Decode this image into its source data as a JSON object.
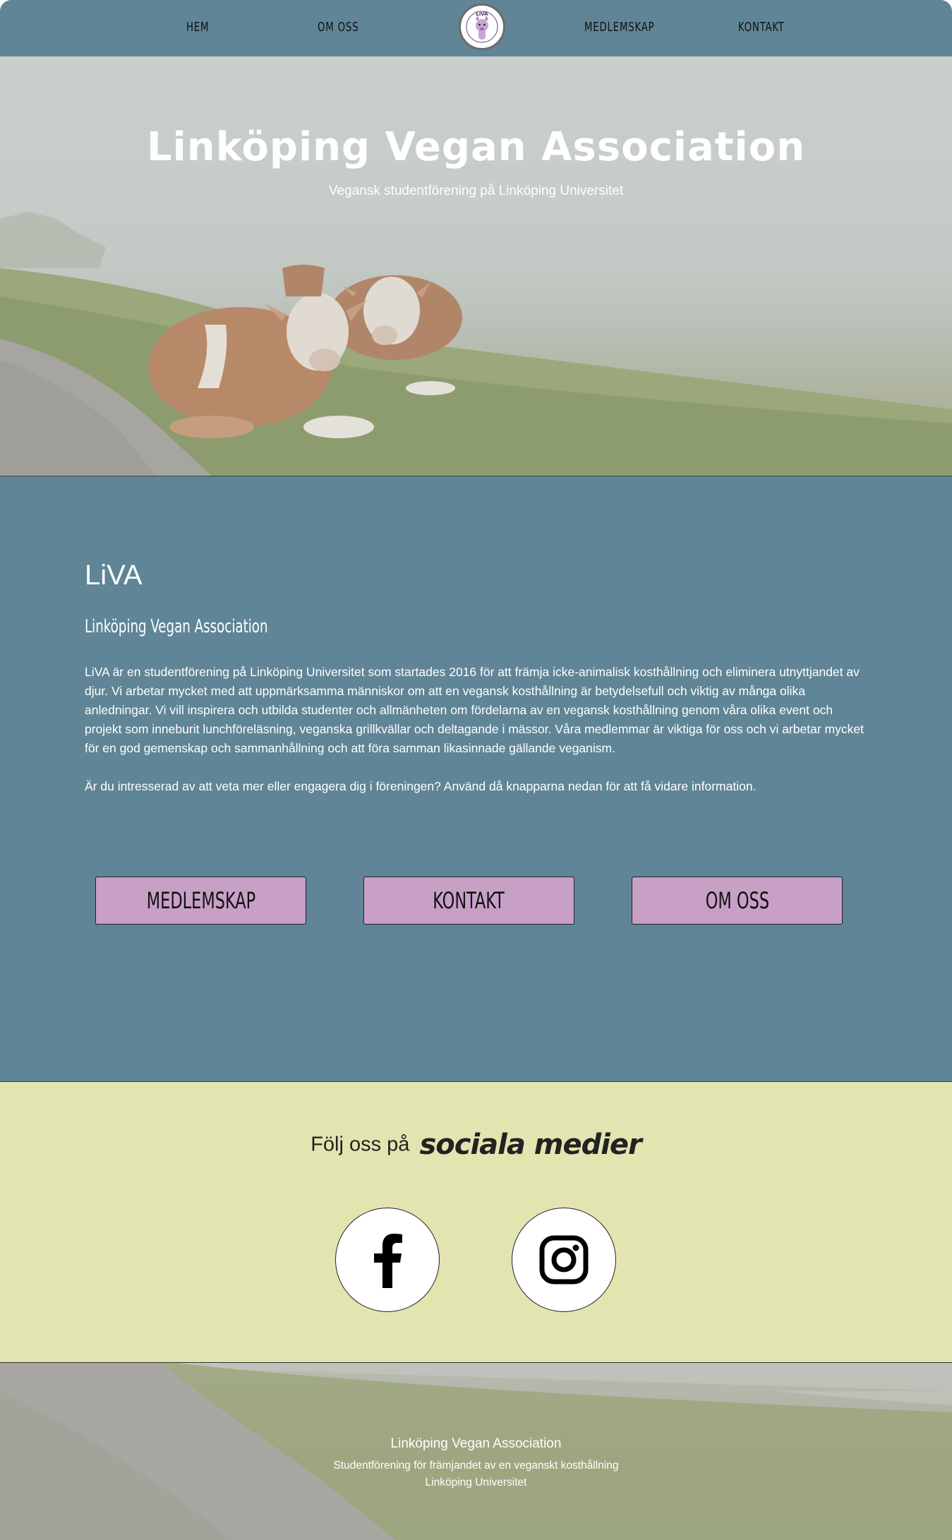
{
  "nav": {
    "items": [
      "HEM",
      "OM OSS",
      "MEDLEMSKAP",
      "KONTAKT"
    ],
    "logo_text": "LiVA"
  },
  "hero": {
    "title": "Linköping Vegan Association",
    "subtitle": "Vegansk studentförening på Linköping Universitet"
  },
  "about": {
    "heading": "LiVA",
    "subheading": "Linköping Vegan Association",
    "paragraph1": "LiVA är en studentförening på Linköping Universitet som startades 2016 för att främja icke-animalisk kosthållning och eliminera utnyttjandet av djur. Vi arbetar mycket med att uppmärksamma människor om att en vegansk kosthållning är betydelsefull och viktig av många olika anledningar. Vi vill inspirera och utbilda studenter och allmänheten om fördelarna av en vegansk kosthållning genom våra olika event och projekt som inneburit lunchföreläsning, veganska grillkvällar och deltagande i mässor. Våra medlemmar är viktiga för oss och vi arbetar mycket för en god gemenskap och sammanhållning och att föra samman likasinnade gällande veganism.",
    "paragraph2": "Är du intresserad av att veta mer eller engagera dig i föreningen? Använd då knapparna nedan för att få vidare information.",
    "buttons": [
      "MEDLEMSKAP",
      "KONTAKT",
      "OM OSS"
    ]
  },
  "social": {
    "heading_pre": "Följ oss på",
    "heading_em": "sociala medier",
    "icons": [
      "facebook-icon",
      "instagram-icon"
    ]
  },
  "footer": {
    "title": "Linköping Vegan Association",
    "line1": "Studentförening för främjandet av en veganskt kosthållning",
    "line2": "Linköping Universitet"
  },
  "colors": {
    "nav_bg": "#5f8596",
    "section_bg": "#5f8596",
    "button_bg": "#c8a0c6",
    "social_bg": "#e2e5b0"
  }
}
